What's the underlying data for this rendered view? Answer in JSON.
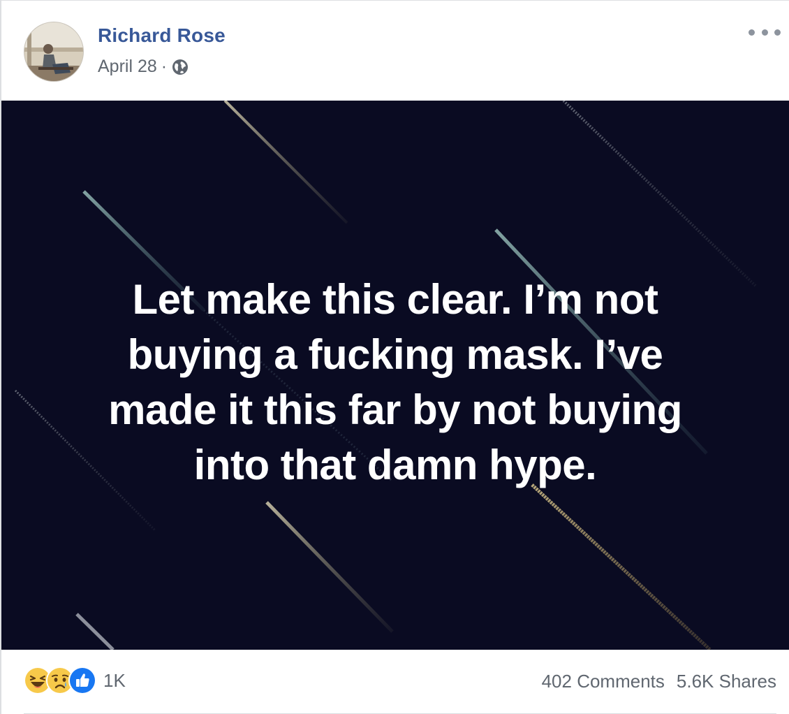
{
  "post": {
    "author": "Richard Rose",
    "date": "April 28",
    "separator": "·",
    "privacy_icon": "globe-icon",
    "more_icon": "more-options-icon",
    "caption_lines": [
      "Let make this clear. I’m not",
      "buying a fucking mask. I’ve",
      "made it this far by not buying",
      "into that damn hype."
    ],
    "background_color": "#0a0b22"
  },
  "footer": {
    "reactions": [
      "haha-icon",
      "sad-icon",
      "like-icon"
    ],
    "reaction_count": "1K",
    "comments": "402 Comments",
    "shares": "5.6K Shares"
  },
  "colors": {
    "author_link": "#385898",
    "meta_text": "#606770",
    "like_blue": "#1877f2",
    "emoji_yellow": "#f7c94a"
  }
}
